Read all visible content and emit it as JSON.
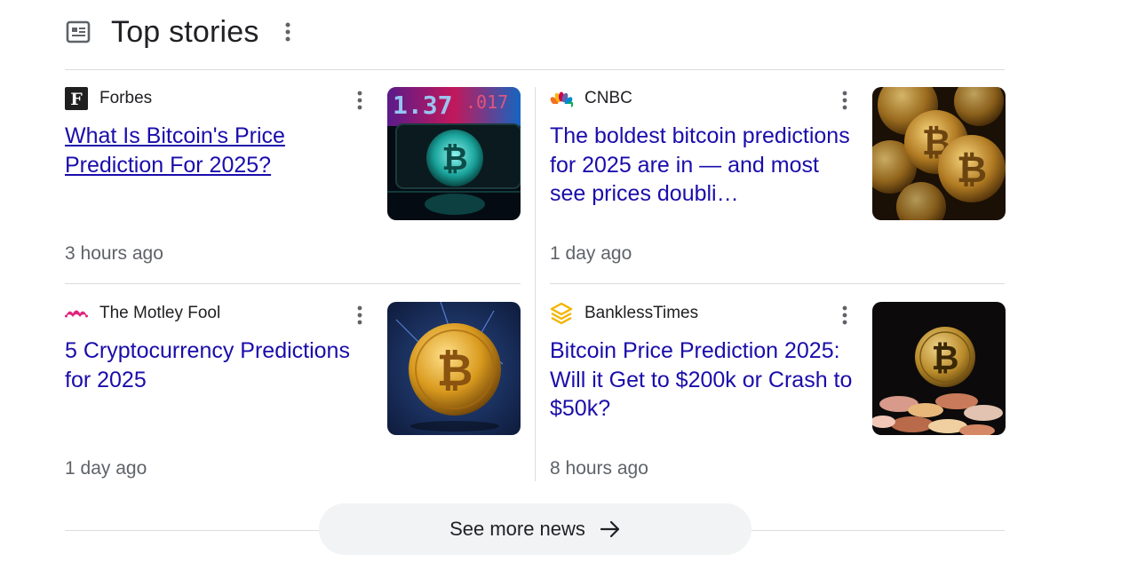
{
  "section": {
    "title": "Top stories",
    "more_button_label": "See more news"
  },
  "colors": {
    "link": "#1a0dab",
    "meta": "#5f6368",
    "divider": "#dadce0",
    "button_bg": "#f1f3f4"
  },
  "stories": [
    {
      "source": "Forbes",
      "favicon": "forbes-f-icon",
      "headline": "What Is Bitcoin's Price Prediction For 2025?",
      "time": "3 hours ago",
      "thumbnail": "bitcoin-digital-teal-image"
    },
    {
      "source": "CNBC",
      "favicon": "cnbc-peacock-icon",
      "headline": "The boldest bitcoin predictions for 2025 are in — and most see prices doubli…",
      "time": "1 day ago",
      "thumbnail": "gold-bitcoin-coins-image"
    },
    {
      "source": "The Motley Fool",
      "favicon": "motley-fool-jester-icon",
      "headline": "5 Cryptocurrency Predictions for 2025",
      "time": "1 day ago",
      "thumbnail": "gold-bitcoin-coin-image"
    },
    {
      "source": "BanklessTimes",
      "favicon": "bankless-times-icon",
      "headline": "Bitcoin Price Prediction 2025: Will it Get to $200k or Crash to $50k?",
      "time": "8 hours ago",
      "thumbnail": "bitcoin-on-coin-pile-image"
    }
  ]
}
